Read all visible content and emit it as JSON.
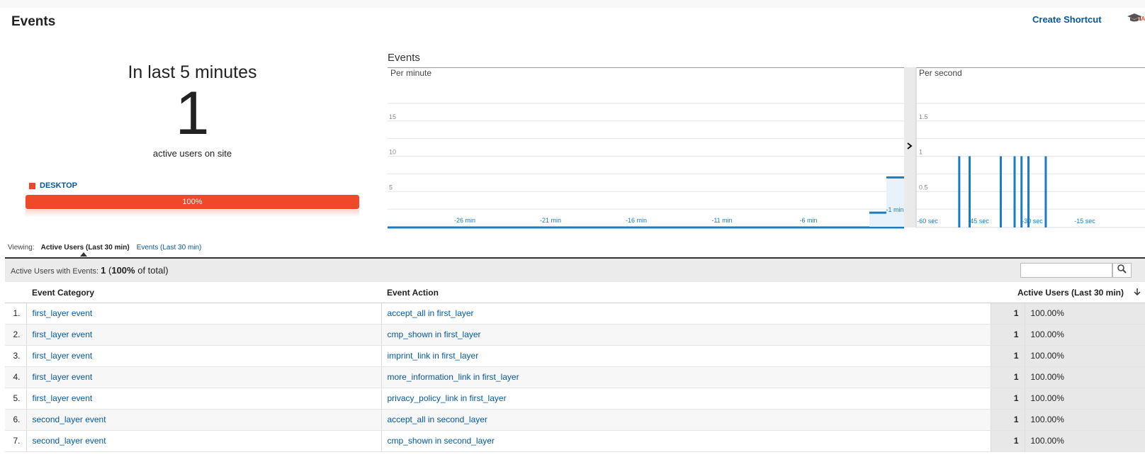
{
  "header": {
    "title": "Events",
    "shortcut_label": "Create Shortcut",
    "beta_label": "BETA"
  },
  "active": {
    "heading": "In last 5 minutes",
    "count": "1",
    "subtitle": "active users on site",
    "device": {
      "label": "DESKTOP",
      "percent_label": "100%",
      "share": 1.0,
      "color": "#f0492a"
    }
  },
  "chart_title": "Events",
  "chart_data": [
    {
      "type": "bar",
      "title": "Per minute",
      "x_tick_labels": [
        "-26 min",
        "-21 min",
        "-16 min",
        "-11 min",
        "-6 min",
        "-1 min"
      ],
      "y_tick_labels": [
        "5",
        "10",
        "15"
      ],
      "ylim": [
        0,
        20
      ],
      "categories": [
        "-2 min",
        "-1 min"
      ],
      "values": [
        2,
        7
      ],
      "grid": true,
      "color": "#1a7cc1"
    },
    {
      "type": "bar",
      "title": "Per second",
      "x_tick_labels": [
        "-60 sec",
        "-45 sec",
        "-30 sec",
        "-15 sec"
      ],
      "y_tick_labels": [
        "0.5",
        "1",
        "1.5"
      ],
      "ylim": [
        0,
        2
      ],
      "x": [
        -50,
        -47,
        -38,
        -34,
        -32,
        -30,
        -25
      ],
      "values": [
        1,
        1,
        1,
        1,
        1,
        1,
        1
      ],
      "grid": true,
      "color": "#1a7cc1"
    }
  ],
  "viewing": {
    "label": "Viewing:",
    "active_tab": "Active Users (Last 30 min)",
    "other_tab": "Events (Last 30 min)"
  },
  "table": {
    "summary_label": "Active Users with Events:",
    "summary_value": "1",
    "summary_pct": "100%",
    "summary_suffix": "of total)",
    "headers": {
      "category": "Event Category",
      "action": "Event Action",
      "metric": "Active Users (Last 30 min)"
    },
    "rows": [
      {
        "idx": "1.",
        "category": "first_layer event",
        "action": "accept_all in first_layer",
        "users": "1",
        "pct": "100.00%"
      },
      {
        "idx": "2.",
        "category": "first_layer event",
        "action": "cmp_shown in first_layer",
        "users": "1",
        "pct": "100.00%"
      },
      {
        "idx": "3.",
        "category": "first_layer event",
        "action": "imprint_link in first_layer",
        "users": "1",
        "pct": "100.00%"
      },
      {
        "idx": "4.",
        "category": "first_layer event",
        "action": "more_information_link in first_layer",
        "users": "1",
        "pct": "100.00%"
      },
      {
        "idx": "5.",
        "category": "first_layer event",
        "action": "privacy_policy_link in first_layer",
        "users": "1",
        "pct": "100.00%"
      },
      {
        "idx": "6.",
        "category": "second_layer event",
        "action": "accept_all in second_layer",
        "users": "1",
        "pct": "100.00%"
      },
      {
        "idx": "7.",
        "category": "second_layer event",
        "action": "cmp_shown in second_layer",
        "users": "1",
        "pct": "100.00%"
      }
    ]
  }
}
